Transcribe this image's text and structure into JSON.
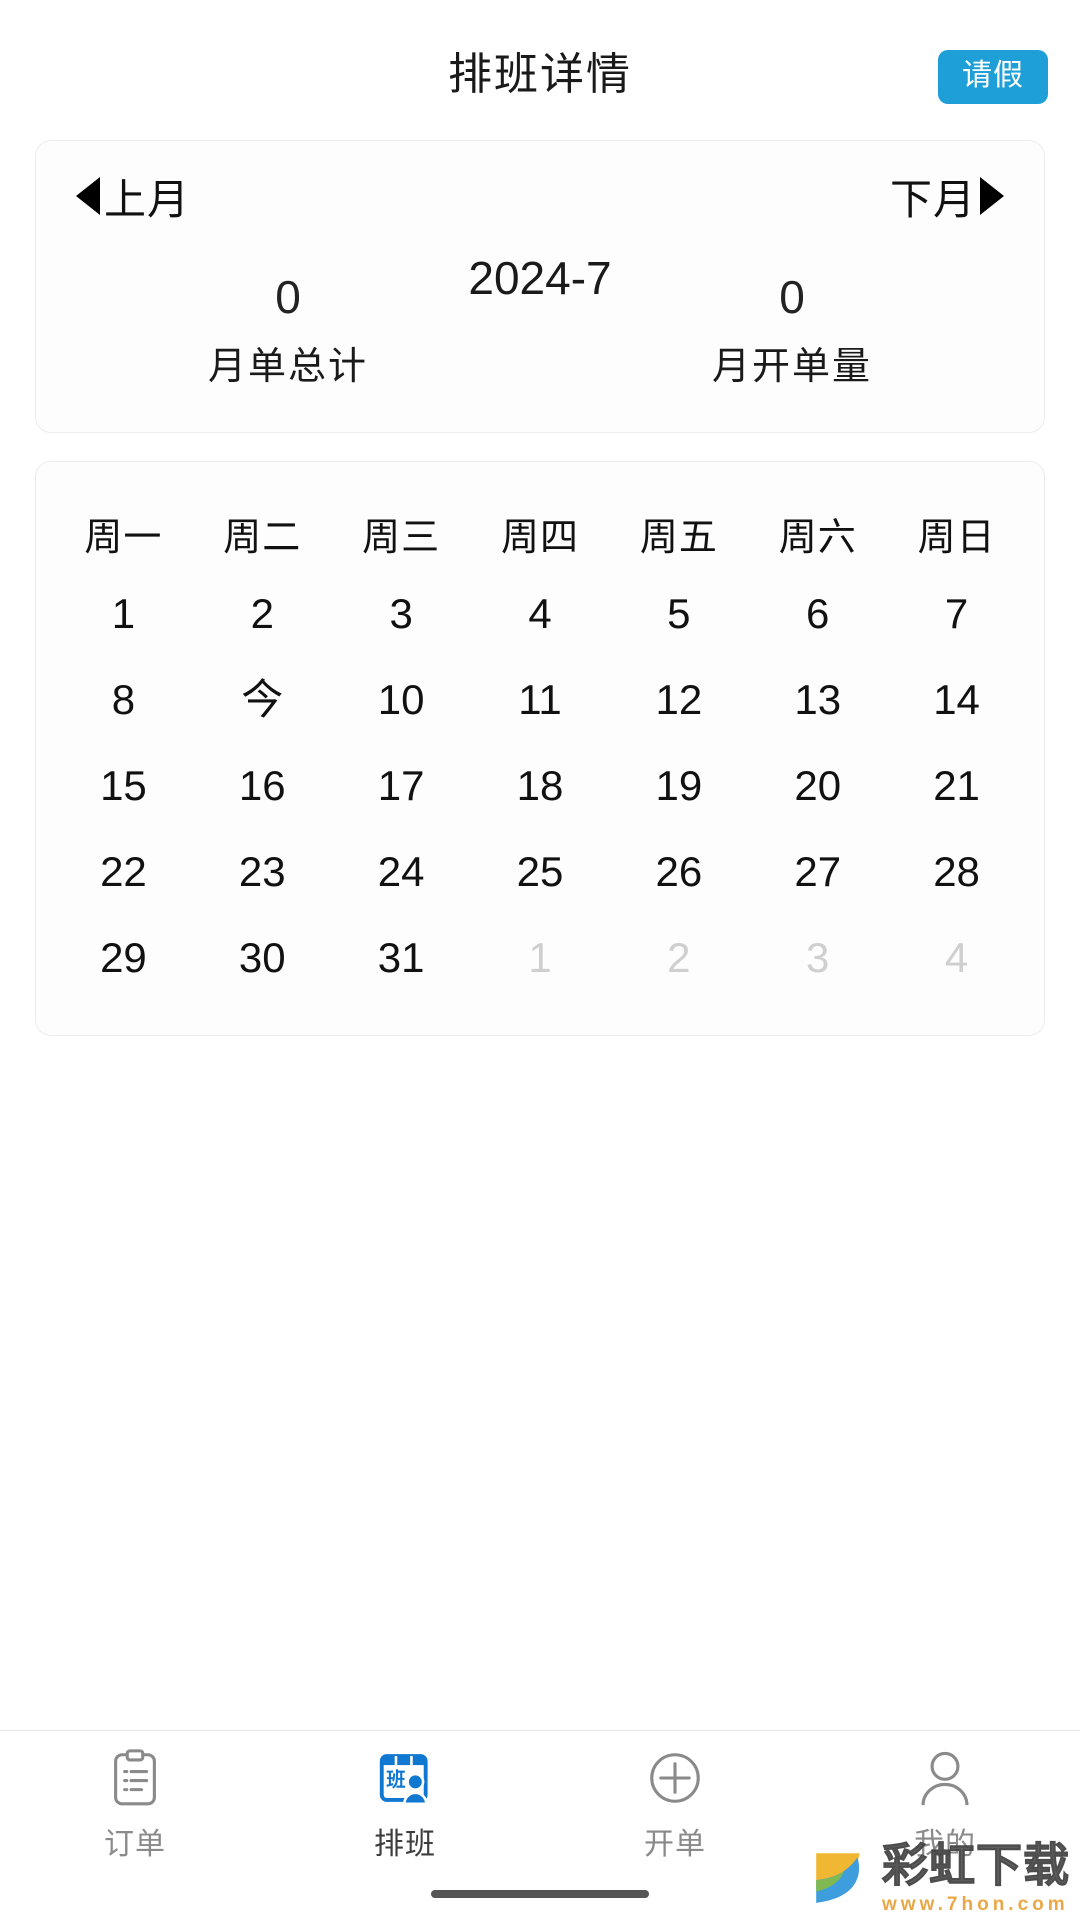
{
  "header": {
    "title": "排班详情",
    "leave_button": "请假"
  },
  "month_nav": {
    "prev_label": "上月",
    "next_label": "下月",
    "current_month": "2024-7"
  },
  "stats": [
    {
      "value": "0",
      "label": "月单总计"
    },
    {
      "value": "0",
      "label": "月开单量"
    }
  ],
  "calendar": {
    "weekdays": [
      "周一",
      "周二",
      "周三",
      "周四",
      "周五",
      "周六",
      "周日"
    ],
    "weeks": [
      [
        {
          "text": "1",
          "state": "current"
        },
        {
          "text": "2",
          "state": "current"
        },
        {
          "text": "3",
          "state": "current"
        },
        {
          "text": "4",
          "state": "current"
        },
        {
          "text": "5",
          "state": "current"
        },
        {
          "text": "6",
          "state": "current"
        },
        {
          "text": "7",
          "state": "current"
        }
      ],
      [
        {
          "text": "8",
          "state": "current"
        },
        {
          "text": "今",
          "state": "today"
        },
        {
          "text": "10",
          "state": "current"
        },
        {
          "text": "11",
          "state": "current"
        },
        {
          "text": "12",
          "state": "current"
        },
        {
          "text": "13",
          "state": "current"
        },
        {
          "text": "14",
          "state": "current"
        }
      ],
      [
        {
          "text": "15",
          "state": "current"
        },
        {
          "text": "16",
          "state": "current"
        },
        {
          "text": "17",
          "state": "current"
        },
        {
          "text": "18",
          "state": "current"
        },
        {
          "text": "19",
          "state": "current"
        },
        {
          "text": "20",
          "state": "current"
        },
        {
          "text": "21",
          "state": "current"
        }
      ],
      [
        {
          "text": "22",
          "state": "current"
        },
        {
          "text": "23",
          "state": "current"
        },
        {
          "text": "24",
          "state": "current"
        },
        {
          "text": "25",
          "state": "current"
        },
        {
          "text": "26",
          "state": "current"
        },
        {
          "text": "27",
          "state": "current"
        },
        {
          "text": "28",
          "state": "current"
        }
      ],
      [
        {
          "text": "29",
          "state": "current"
        },
        {
          "text": "30",
          "state": "current"
        },
        {
          "text": "31",
          "state": "current"
        },
        {
          "text": "1",
          "state": "muted"
        },
        {
          "text": "2",
          "state": "muted"
        },
        {
          "text": "3",
          "state": "muted"
        },
        {
          "text": "4",
          "state": "muted"
        }
      ]
    ]
  },
  "tabbar": {
    "items": [
      {
        "label": "订单",
        "icon": "clipboard-list-icon",
        "active": false
      },
      {
        "label": "排班",
        "icon": "schedule-badge-icon",
        "active": true
      },
      {
        "label": "开单",
        "icon": "plus-circle-icon",
        "active": false
      },
      {
        "label": "我的",
        "icon": "person-icon",
        "active": false
      }
    ]
  },
  "watermark": {
    "name": "彩虹下载",
    "url": "www.7hon.com"
  },
  "colors": {
    "accent": "#1e9fd8",
    "active_tab": "#1078d0",
    "inactive_tab": "#8a8a8a",
    "muted_day": "#cfcfcf",
    "card_border": "#ededed"
  }
}
